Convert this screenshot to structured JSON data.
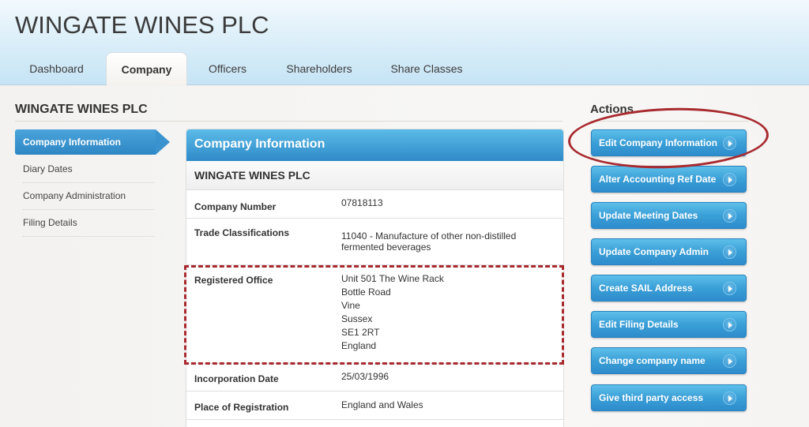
{
  "app": {
    "title": "WINGATE WINES PLC"
  },
  "tabs": [
    {
      "label": "Dashboard",
      "active": false
    },
    {
      "label": "Company",
      "active": true
    },
    {
      "label": "Officers",
      "active": false
    },
    {
      "label": "Shareholders",
      "active": false
    },
    {
      "label": "Share Classes",
      "active": false
    }
  ],
  "page": {
    "heading": "WINGATE WINES PLC"
  },
  "sidebar": {
    "items": [
      {
        "label": "Company Information",
        "active": true
      },
      {
        "label": "Diary Dates",
        "active": false
      },
      {
        "label": "Company Administration",
        "active": false
      },
      {
        "label": "Filing Details",
        "active": false
      }
    ]
  },
  "panel": {
    "title": "Company Information",
    "company_name": "WINGATE WINES PLC",
    "rows": {
      "company_number": {
        "label": "Company Number",
        "value": "07818113"
      },
      "trade_classifications": {
        "label": "Trade Classifications",
        "value": "11040 - Manufacture of other non-distilled fermented beverages"
      },
      "registered_office": {
        "label": "Registered Office",
        "lines": [
          "Unit 501 The Wine Rack",
          "Bottle Road",
          "Vine",
          "Sussex",
          "SE1 2RT",
          "England"
        ]
      },
      "incorporation_date": {
        "label": "Incorporation Date",
        "value": "25/03/1996"
      },
      "place_of_registration": {
        "label": "Place of Registration",
        "value": "England and Wales"
      }
    }
  },
  "actions": {
    "title": "Actions",
    "buttons": [
      {
        "label": "Edit Company Information",
        "highlighted": true
      },
      {
        "label": "Alter Accounting Ref Date"
      },
      {
        "label": "Update Meeting Dates"
      },
      {
        "label": "Update Company Admin"
      },
      {
        "label": "Create SAIL Address"
      },
      {
        "label": "Edit Filing Details"
      },
      {
        "label": "Change company name"
      },
      {
        "label": "Give third party access"
      }
    ]
  },
  "colors": {
    "accent_blue": "#2e8ccc",
    "annotation_red": "#a82a2f"
  }
}
